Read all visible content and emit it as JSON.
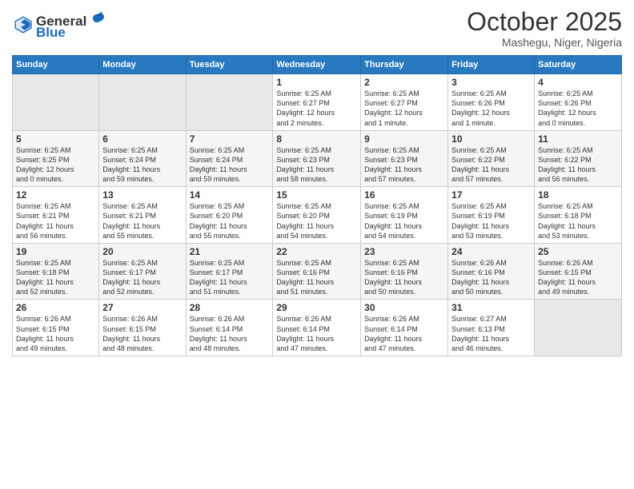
{
  "header": {
    "logo_general": "General",
    "logo_blue": "Blue",
    "month": "October 2025",
    "location": "Mashegu, Niger, Nigeria"
  },
  "days_of_week": [
    "Sunday",
    "Monday",
    "Tuesday",
    "Wednesday",
    "Thursday",
    "Friday",
    "Saturday"
  ],
  "weeks": [
    [
      {
        "day": "",
        "info": ""
      },
      {
        "day": "",
        "info": ""
      },
      {
        "day": "",
        "info": ""
      },
      {
        "day": "1",
        "info": "Sunrise: 6:25 AM\nSunset: 6:27 PM\nDaylight: 12 hours\nand 2 minutes."
      },
      {
        "day": "2",
        "info": "Sunrise: 6:25 AM\nSunset: 6:27 PM\nDaylight: 12 hours\nand 1 minute."
      },
      {
        "day": "3",
        "info": "Sunrise: 6:25 AM\nSunset: 6:26 PM\nDaylight: 12 hours\nand 1 minute."
      },
      {
        "day": "4",
        "info": "Sunrise: 6:25 AM\nSunset: 6:26 PM\nDaylight: 12 hours\nand 0 minutes."
      }
    ],
    [
      {
        "day": "5",
        "info": "Sunrise: 6:25 AM\nSunset: 6:25 PM\nDaylight: 12 hours\nand 0 minutes."
      },
      {
        "day": "6",
        "info": "Sunrise: 6:25 AM\nSunset: 6:24 PM\nDaylight: 11 hours\nand 59 minutes."
      },
      {
        "day": "7",
        "info": "Sunrise: 6:25 AM\nSunset: 6:24 PM\nDaylight: 11 hours\nand 59 minutes."
      },
      {
        "day": "8",
        "info": "Sunrise: 6:25 AM\nSunset: 6:23 PM\nDaylight: 11 hours\nand 58 minutes."
      },
      {
        "day": "9",
        "info": "Sunrise: 6:25 AM\nSunset: 6:23 PM\nDaylight: 11 hours\nand 57 minutes."
      },
      {
        "day": "10",
        "info": "Sunrise: 6:25 AM\nSunset: 6:22 PM\nDaylight: 11 hours\nand 57 minutes."
      },
      {
        "day": "11",
        "info": "Sunrise: 6:25 AM\nSunset: 6:22 PM\nDaylight: 11 hours\nand 56 minutes."
      }
    ],
    [
      {
        "day": "12",
        "info": "Sunrise: 6:25 AM\nSunset: 6:21 PM\nDaylight: 11 hours\nand 56 minutes."
      },
      {
        "day": "13",
        "info": "Sunrise: 6:25 AM\nSunset: 6:21 PM\nDaylight: 11 hours\nand 55 minutes."
      },
      {
        "day": "14",
        "info": "Sunrise: 6:25 AM\nSunset: 6:20 PM\nDaylight: 11 hours\nand 55 minutes."
      },
      {
        "day": "15",
        "info": "Sunrise: 6:25 AM\nSunset: 6:20 PM\nDaylight: 11 hours\nand 54 minutes."
      },
      {
        "day": "16",
        "info": "Sunrise: 6:25 AM\nSunset: 6:19 PM\nDaylight: 11 hours\nand 54 minutes."
      },
      {
        "day": "17",
        "info": "Sunrise: 6:25 AM\nSunset: 6:19 PM\nDaylight: 11 hours\nand 53 minutes."
      },
      {
        "day": "18",
        "info": "Sunrise: 6:25 AM\nSunset: 6:18 PM\nDaylight: 11 hours\nand 53 minutes."
      }
    ],
    [
      {
        "day": "19",
        "info": "Sunrise: 6:25 AM\nSunset: 6:18 PM\nDaylight: 11 hours\nand 52 minutes."
      },
      {
        "day": "20",
        "info": "Sunrise: 6:25 AM\nSunset: 6:17 PM\nDaylight: 11 hours\nand 52 minutes."
      },
      {
        "day": "21",
        "info": "Sunrise: 6:25 AM\nSunset: 6:17 PM\nDaylight: 11 hours\nand 51 minutes."
      },
      {
        "day": "22",
        "info": "Sunrise: 6:25 AM\nSunset: 6:16 PM\nDaylight: 11 hours\nand 51 minutes."
      },
      {
        "day": "23",
        "info": "Sunrise: 6:25 AM\nSunset: 6:16 PM\nDaylight: 11 hours\nand 50 minutes."
      },
      {
        "day": "24",
        "info": "Sunrise: 6:26 AM\nSunset: 6:16 PM\nDaylight: 11 hours\nand 50 minutes."
      },
      {
        "day": "25",
        "info": "Sunrise: 6:26 AM\nSunset: 6:15 PM\nDaylight: 11 hours\nand 49 minutes."
      }
    ],
    [
      {
        "day": "26",
        "info": "Sunrise: 6:26 AM\nSunset: 6:15 PM\nDaylight: 11 hours\nand 49 minutes."
      },
      {
        "day": "27",
        "info": "Sunrise: 6:26 AM\nSunset: 6:15 PM\nDaylight: 11 hours\nand 48 minutes."
      },
      {
        "day": "28",
        "info": "Sunrise: 6:26 AM\nSunset: 6:14 PM\nDaylight: 11 hours\nand 48 minutes."
      },
      {
        "day": "29",
        "info": "Sunrise: 6:26 AM\nSunset: 6:14 PM\nDaylight: 11 hours\nand 47 minutes."
      },
      {
        "day": "30",
        "info": "Sunrise: 6:26 AM\nSunset: 6:14 PM\nDaylight: 11 hours\nand 47 minutes."
      },
      {
        "day": "31",
        "info": "Sunrise: 6:27 AM\nSunset: 6:13 PM\nDaylight: 11 hours\nand 46 minutes."
      },
      {
        "day": "",
        "info": ""
      }
    ]
  ]
}
